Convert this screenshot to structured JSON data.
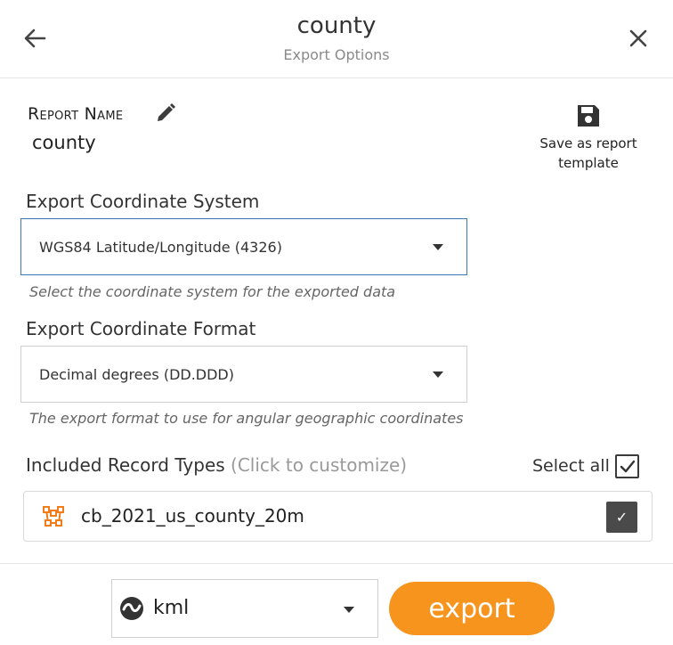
{
  "header": {
    "title": "county",
    "subtitle": "Export Options"
  },
  "report": {
    "name_label": "Report Name",
    "name_value": "county",
    "save_template_label_line1": "Save as report",
    "save_template_label_line2": "template"
  },
  "coordinate_system": {
    "label": "Export Coordinate System",
    "selected": "WGS84 Latitude/Longitude (4326)",
    "hint": "Select the coordinate system for the exported data"
  },
  "coordinate_format": {
    "label": "Export Coordinate Format",
    "selected": "Decimal degrees (DD.DDD)",
    "hint": "The export format to use for angular geographic coordinates"
  },
  "record_types": {
    "label": "Included Record Types",
    "label_hint": "(Click to customize)",
    "select_all_label": "Select all",
    "select_all_checked": true,
    "items": [
      {
        "name": "cb_2021_us_county_20m",
        "checked": true,
        "check_glyph": "✓"
      }
    ]
  },
  "footer": {
    "format_selected": "kml",
    "export_label": "export"
  },
  "colors": {
    "accent": "#f7941e",
    "focus_border": "#3a78b8",
    "layer_icon": "#f07d1a"
  },
  "icons": {
    "back": "arrow-left-icon",
    "close": "close-icon",
    "edit": "pencil-icon",
    "save": "floppy-disk-icon",
    "layer": "polygon-layer-icon",
    "format": "kml-format-icon"
  }
}
